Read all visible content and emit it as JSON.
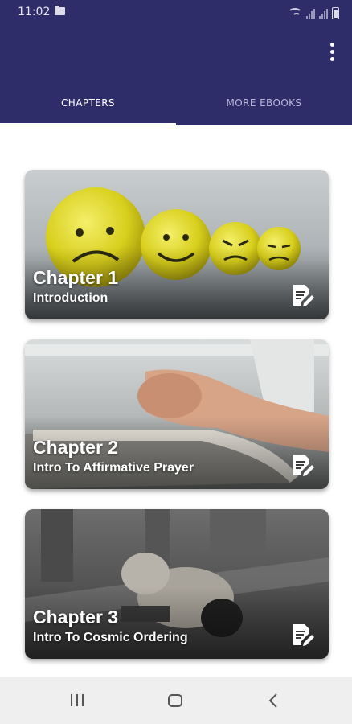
{
  "status_bar": {
    "time": "11:02",
    "icons": [
      "folder-icon",
      "wifi-icon",
      "signal-icon",
      "signal-icon",
      "battery-icon"
    ]
  },
  "app_bar": {
    "background_color": "#2f2c6a",
    "menu_icon": "more-vert-icon",
    "tabs": [
      {
        "label": "CHAPTERS",
        "active": true
      },
      {
        "label": "MORE EBOOKS",
        "active": false
      }
    ]
  },
  "chapters": [
    {
      "title": "Chapter 1",
      "subtitle": "Introduction",
      "image": "emoji-balls-image",
      "icon": "read-note-icon"
    },
    {
      "title": "Chapter 2",
      "subtitle": "Intro To Affirmative Prayer",
      "image": "praying-hands-image",
      "icon": "read-note-icon"
    },
    {
      "title": "Chapter 3",
      "subtitle": "Intro To Cosmic Ordering",
      "image": "prostrating-man-image",
      "icon": "read-note-icon"
    }
  ],
  "nav_bar": {
    "buttons": [
      "recents-icon",
      "home-icon",
      "back-icon"
    ]
  }
}
